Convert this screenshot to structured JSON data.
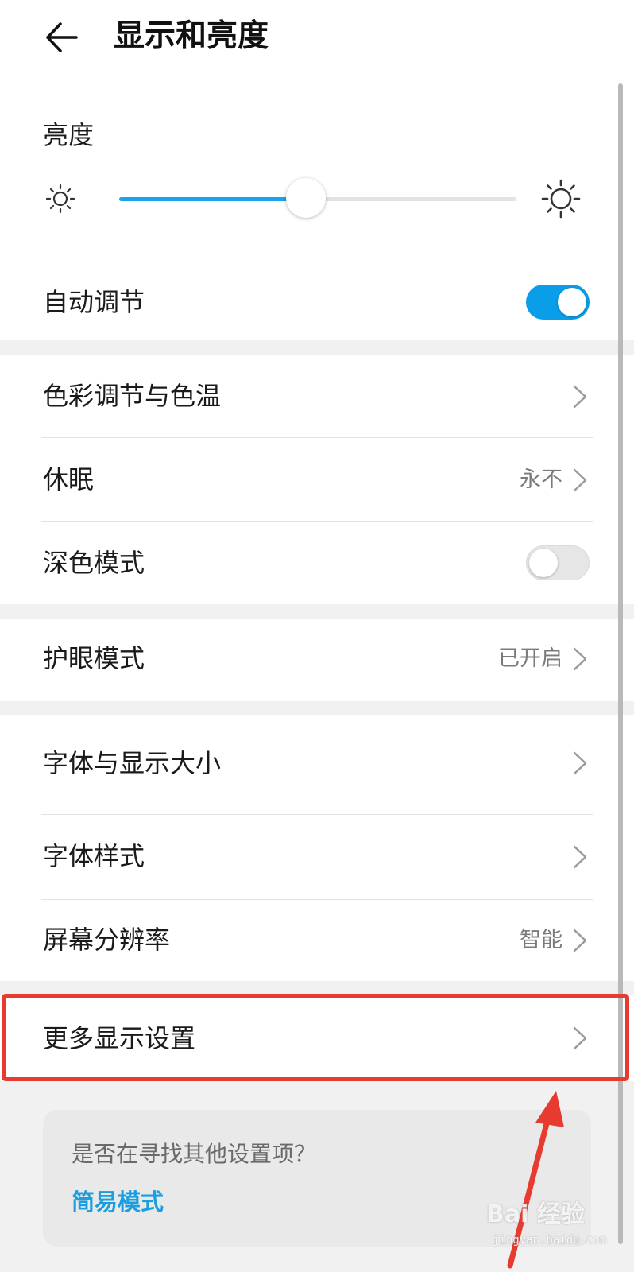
{
  "header": {
    "title": "显示和亮度",
    "back_icon": "back-arrow-icon"
  },
  "brightness": {
    "label": "亮度",
    "level_percent": 47,
    "auto_label": "自动调节",
    "auto_on": true
  },
  "display_section": {
    "items": [
      {
        "label": "色彩调节与色温",
        "value": ""
      },
      {
        "label": "休眠",
        "value": "永不"
      },
      {
        "label": "深色模式",
        "toggle_on": false
      }
    ]
  },
  "eye_section": {
    "items": [
      {
        "label": "护眼模式",
        "value": "已开启"
      }
    ]
  },
  "font_section": {
    "items": [
      {
        "label": "字体与显示大小",
        "value": ""
      },
      {
        "label": "字体样式",
        "value": ""
      },
      {
        "label": "屏幕分辨率",
        "value": "智能"
      }
    ]
  },
  "more_section": {
    "label": "更多显示设置"
  },
  "help_card": {
    "question": "是否在寻找其他设置项？",
    "link": "简易模式"
  },
  "watermark": {
    "brand": "Bai  经验",
    "url": "jingyan.baidu.com"
  },
  "colors": {
    "accent": "#0a9ee8",
    "annotation_red": "#e63b2e"
  }
}
